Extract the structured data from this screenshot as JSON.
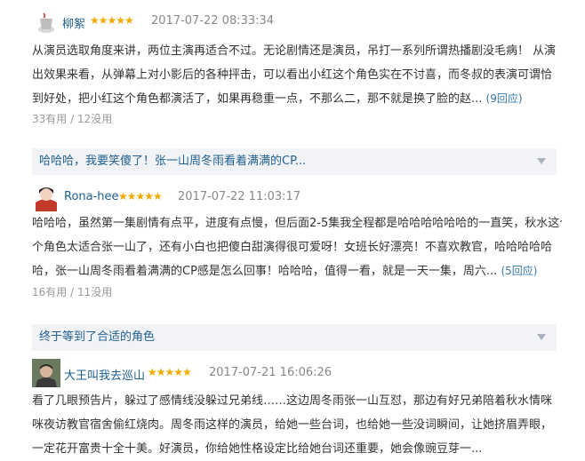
{
  "reviews": [
    {
      "username": "柳絮",
      "stars": "★★★★★",
      "time": "2017-07-22 08:33:34",
      "lines": [
        "从演员选取角度来讲，两位主演再适合不过。无论剧情还是演员，吊打一系列所谓热播剧没毛病！ 从演",
        "出效果来看，从弹幕上对小影后的各种抨击，可以看出小红这个角色实在不讨喜，而冬叔的表演可谓恰",
        "到好处，把小红这个角色都演活了，如果再稳重一点，不那么二，那不就是换了脸的赵..."
      ],
      "reply_label": "(9回应)",
      "votes": "33有用 / 12没用"
    },
    {
      "title": "哈哈哈，我要笑傻了！张一山周冬雨看着满满的CP...",
      "username": "Rona-hee",
      "stars": "★★★★★",
      "time": "2017-07-22 11:03:17",
      "lines": [
        "哈哈哈，虽然第一集剧情有点平，进度有点慢，但后面2-5集我全程都是哈哈哈哈哈哈的一直笑，秋水这个",
        "个角色太适合张一山了，还有小白也把傻白甜演得很可爱呀！女班长好漂亮！不喜欢教官，哈哈哈哈哈",
        "哈，张一山周冬雨看着满满的CP感是怎么回事！哈哈哈，值得一看，就是一天一集，周六..."
      ],
      "reply_label": "(5回应)",
      "votes": "16有用 / 11没用"
    },
    {
      "title": "终于等到了合适的角色",
      "username": "大王叫我去巡山",
      "stars": "★★★★★",
      "time": "2017-07-21 16:06:26",
      "lines": [
        "看了几眼预告片，躲过了感情线没躲过兄弟线……这边周冬雨张一山互怼，那边有好兄弟陪着秋水情咪",
        "咪夜访教官宿舍偷红烧肉。周冬雨这样的演员，给她一些台词，也给她一些没词瞬间，让她挤眉弄眼，",
        "一定花开富贵十全十美。好演员，你给她性格设定比给她台词还重要，她会像豌豆芽一..."
      ]
    }
  ],
  "colors": {
    "username": "#1f5f8f",
    "star": "#f2a900",
    "reply_link": "#3377aa",
    "section_bg": "#f1f3f6"
  },
  "icons": {
    "collapse": "chevron-down-icon"
  }
}
